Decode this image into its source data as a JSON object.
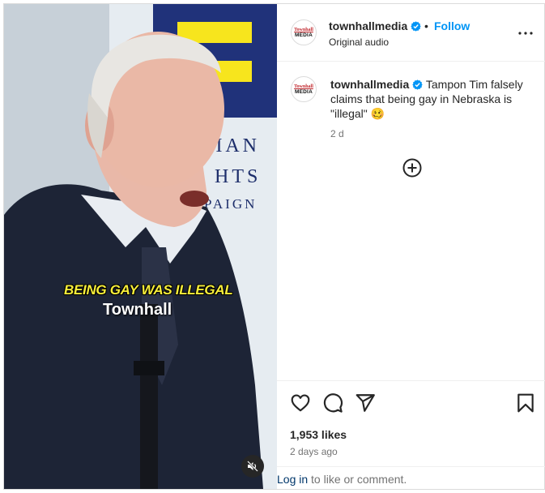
{
  "media": {
    "caption_primary": "BEING GAY WAS ILLEGAL",
    "caption_watermark": "Townhall",
    "backdrop_letters": [
      "MAN",
      "HTS",
      "PAIGN"
    ],
    "mute_icon": "speaker-muted-icon"
  },
  "header": {
    "avatar_line1": "Townhall",
    "avatar_line2": "MEDIA",
    "username": "townhallmedia",
    "separator": "•",
    "follow_label": "Follow",
    "audio_label": "Original audio",
    "more_icon": "more-horizontal-icon"
  },
  "caption": {
    "username": "townhallmedia",
    "text": " Tampon Tim falsely claims that being gay in Nebraska is \"illegal\" ",
    "emoji": "🥴",
    "time": "2 d"
  },
  "actions": {
    "likes": "1,953 likes",
    "time_ago": "2 days ago",
    "login_label": "Log in",
    "login_suffix": " to like or comment."
  },
  "colors": {
    "accent_blue": "#0095f6",
    "verified_blue": "#0095f6",
    "link_dark": "#00376b",
    "caption_yellow": "#f7ee3a",
    "hrc_blue": "#20327a",
    "hrc_yellow": "#f7e51d"
  }
}
